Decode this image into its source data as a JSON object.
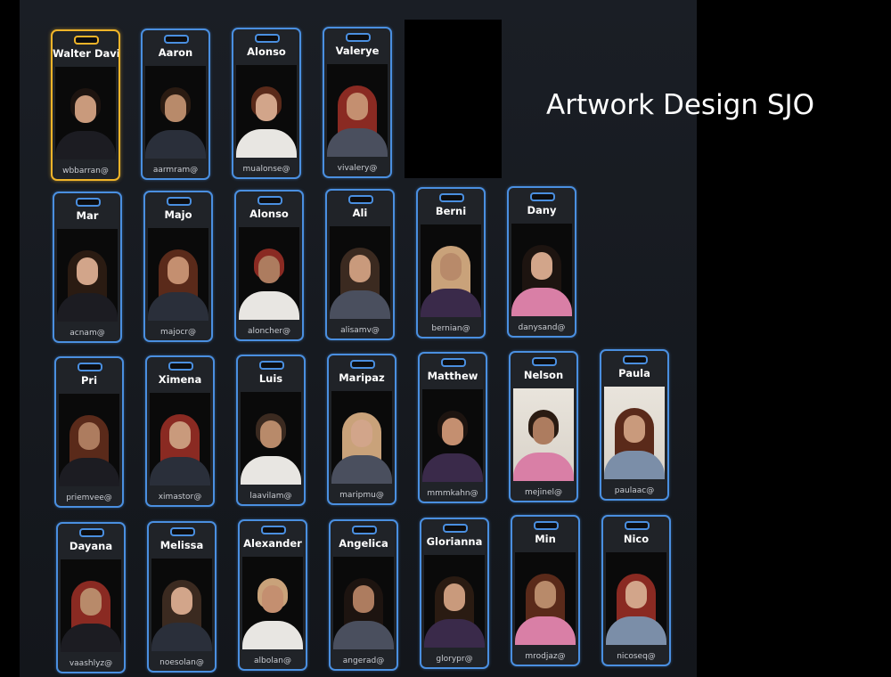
{
  "header": {
    "title": "Artwork Design SJO"
  },
  "colors": {
    "board_bg": "#16191f",
    "badge_border": "#4a8fe0",
    "selected_border": "#f0b429"
  },
  "rows": [
    [
      {
        "name": "Walter David",
        "handle": "wbbarran@",
        "selected": true
      },
      {
        "name": "Aaron",
        "handle": "aarmram@"
      },
      {
        "name": "Alonso",
        "handle": "mualonse@"
      },
      {
        "name": "Valerye",
        "handle": "vivalery@"
      }
    ],
    [
      {
        "name": "Mar",
        "handle": "acnam@"
      },
      {
        "name": "Majo",
        "handle": "majocr@"
      },
      {
        "name": "Alonso",
        "handle": "aloncher@"
      },
      {
        "name": "Ali",
        "handle": "alisamv@"
      },
      {
        "name": "Berni",
        "handle": "bernian@"
      },
      {
        "name": "Dany",
        "handle": "danysand@"
      }
    ],
    [
      {
        "name": "Pri",
        "handle": "priemvee@"
      },
      {
        "name": "Ximena",
        "handle": "ximastor@"
      },
      {
        "name": "Luis",
        "handle": "laavilam@"
      },
      {
        "name": "Maripaz",
        "handle": "maripmu@"
      },
      {
        "name": "Matthew",
        "handle": "mmmkahn@"
      },
      {
        "name": "Nelson",
        "handle": "mejinel@"
      },
      {
        "name": "Paula",
        "handle": "paulaac@"
      }
    ],
    [
      {
        "name": "Dayana",
        "handle": "vaashlyz@"
      },
      {
        "name": "Melissa",
        "handle": "noesolan@"
      },
      {
        "name": "Alexander",
        "handle": "albolan@"
      },
      {
        "name": "Angelica",
        "handle": "angerad@"
      },
      {
        "name": "Glorianna",
        "handle": "glorypr@"
      },
      {
        "name": "Min",
        "handle": "mrodjaz@"
      },
      {
        "name": "Nico",
        "handle": "nicoseq@"
      }
    ]
  ]
}
